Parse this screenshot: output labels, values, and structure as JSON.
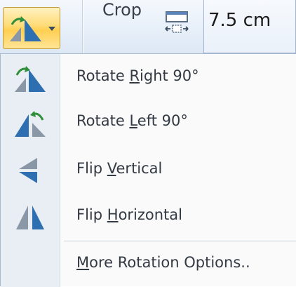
{
  "ribbon": {
    "rotate_button": {
      "icon": "rotate-right-icon"
    },
    "crop_label": "Crop",
    "crop_size_icon": "crop-size-icon",
    "crop_width_value": "7.5 cm"
  },
  "menu": {
    "items": [
      {
        "icon": "rotate-right-icon",
        "prefix": "Rotate ",
        "accel": "R",
        "suffix": "ight 90°"
      },
      {
        "icon": "rotate-left-icon",
        "prefix": "Rotate ",
        "accel": "L",
        "suffix": "eft 90°"
      },
      {
        "icon": "flip-vertical-icon",
        "prefix": "Flip ",
        "accel": "V",
        "suffix": "ertical"
      },
      {
        "icon": "flip-horizontal-icon",
        "prefix": "Flip ",
        "accel": "H",
        "suffix": "orizontal"
      }
    ],
    "more": {
      "prefix": "",
      "accel": "M",
      "suffix": "ore Rotation Options.."
    }
  },
  "colors": {
    "hover_gradient_top": "#fff1c2",
    "hover_gradient_bottom": "#ffcf52",
    "icon_blue": "#2d6fb1",
    "icon_gray": "#7b8a9a",
    "arrow_green": "#2f8f3a"
  }
}
